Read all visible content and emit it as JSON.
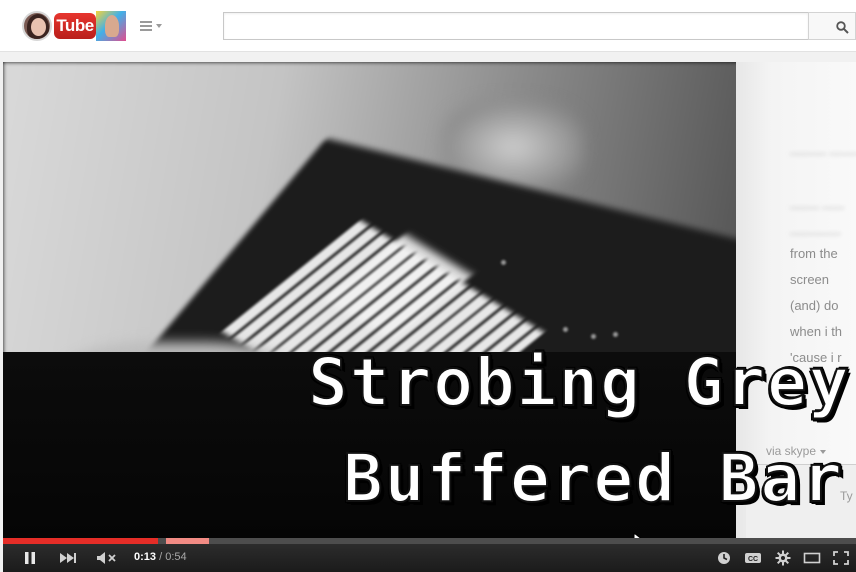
{
  "header": {
    "logo_text": "Tube",
    "search": {
      "value": "",
      "placeholder": ""
    },
    "icons": {
      "guide": "hamburger-menu-icon",
      "search": "magnifier-icon"
    }
  },
  "video": {
    "overlay_title": {
      "line1": "Strobing Grey",
      "line2": "Buffered Bar"
    },
    "chat_overlay": {
      "lines": [
        "from the",
        "screen",
        "(and) do",
        "when i th",
        "'cause i r"
      ],
      "skype_label": "via skype",
      "typing_hint": "Ty"
    }
  },
  "player": {
    "progress": {
      "played_fraction": 0.182,
      "buffer_start_fraction": 0.191,
      "buffer_end_fraction": 0.242,
      "played_color": "#e52d27",
      "buffer_color": "#f28b84",
      "track_color": "#4d4d4d"
    },
    "time": {
      "current": "0:13",
      "separator": "/",
      "duration": "0:54"
    },
    "icons": {
      "play_pause": "pause-icon",
      "next": "next-icon",
      "volume": "mute-icon",
      "watch_later": "watch-later-icon",
      "captions": "captions-icon",
      "settings": "gear-icon",
      "theater": "theater-mode-icon",
      "fullscreen": "fullscreen-icon"
    }
  },
  "colors": {
    "brand_red": "#e52d27",
    "masthead_bg": "#ffffff",
    "page_bg": "#f1f1f1"
  }
}
